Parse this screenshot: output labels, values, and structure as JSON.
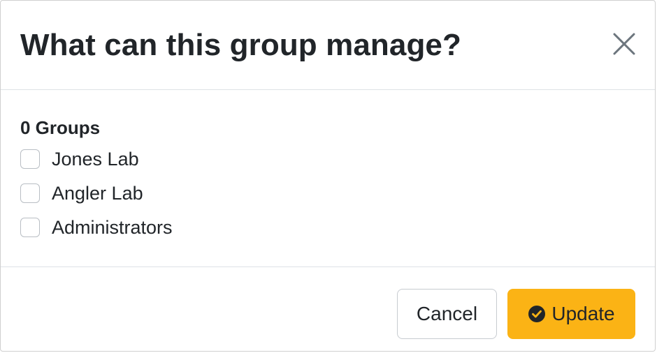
{
  "dialog": {
    "title": "What can this group manage?",
    "close_icon": "close-icon"
  },
  "body": {
    "group_count_label": "0 Groups",
    "groups": [
      {
        "label": "Jones Lab",
        "checked": false
      },
      {
        "label": "Angler Lab",
        "checked": false
      },
      {
        "label": "Administrators",
        "checked": false
      }
    ]
  },
  "footer": {
    "cancel_label": "Cancel",
    "update_label": "Update",
    "update_icon": "check-circle-icon"
  },
  "colors": {
    "accent": "#fbb315",
    "text": "#212529",
    "border": "#dee2e6"
  }
}
